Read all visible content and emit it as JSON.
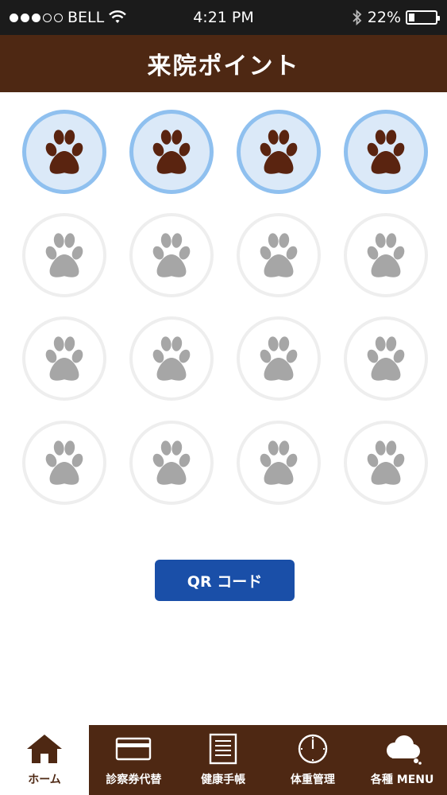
{
  "status_bar": {
    "carrier": "BELL",
    "time": "4:21 PM",
    "battery_percent": "22%",
    "battery_level": 0.22,
    "signal_filled": 3,
    "signal_total": 5
  },
  "header": {
    "title": "来院ポイント"
  },
  "stamps": {
    "total": 16,
    "earned": 4,
    "earned_color": "#5a2410",
    "empty_color": "#a6a6a6"
  },
  "qr_button": {
    "label": "QR コード"
  },
  "tabs": [
    {
      "label": "ホーム",
      "icon": "house-icon",
      "active": true
    },
    {
      "label": "診察券代替",
      "icon": "card-icon",
      "active": false
    },
    {
      "label": "健康手帳",
      "icon": "notebook-icon",
      "active": false
    },
    {
      "label": "体重管理",
      "icon": "clock-icon",
      "active": false
    },
    {
      "label": "各種 MENU",
      "icon": "cloud-icon",
      "active": false
    }
  ],
  "colors": {
    "header_brown": "#4e2813",
    "button_blue": "#1a4fa8",
    "stamp_ring": "#8fc0ef"
  }
}
